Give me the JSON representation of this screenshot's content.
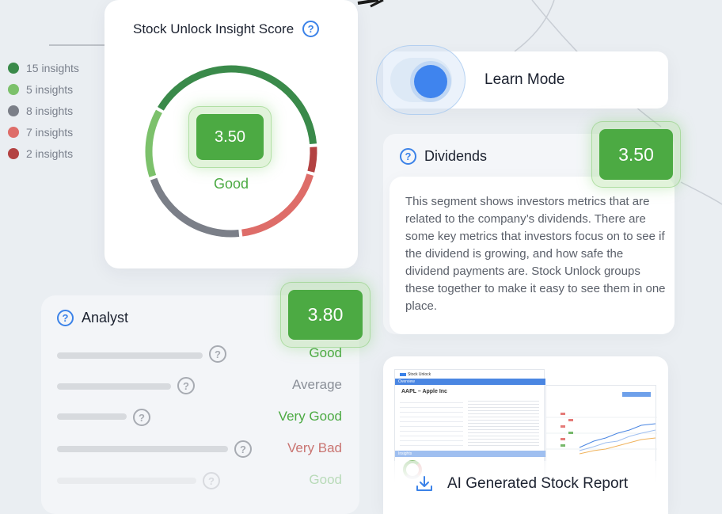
{
  "legend": [
    {
      "label": "15 insights",
      "color": "#3a8a4a"
    },
    {
      "label": "5 insights",
      "color": "#7cc16b"
    },
    {
      "label": "8 insights",
      "color": "#7b7f88"
    },
    {
      "label": "7 insights",
      "color": "#de6d69"
    },
    {
      "label": "2 insights",
      "color": "#b34242"
    }
  ],
  "score_card": {
    "title": "Stock Unlock Insight Score",
    "score": "3.50",
    "rating": "Good",
    "segments": [
      {
        "name": "15 insights",
        "value": 15,
        "color": "#3a8a4a"
      },
      {
        "name": "2 insights",
        "value": 2,
        "color": "#b34242"
      },
      {
        "name": "7 insights",
        "value": 7,
        "color": "#de6d69"
      },
      {
        "name": "8 insights",
        "value": 8,
        "color": "#7b7f88"
      },
      {
        "name": "5 insights",
        "value": 5,
        "color": "#7cc16b"
      }
    ]
  },
  "learn_mode": {
    "label": "Learn Mode",
    "enabled": true,
    "accent": "#3f84ee"
  },
  "dividends": {
    "title": "Dividends",
    "score": "3.50",
    "description": "This segment shows investors metrics that are related to the company’s dividends. There are some key metrics that investors focus on to see if the dividend is growing, and how safe the dividend payments are. Stock Unlock groups these together to make it easy to see them in one place."
  },
  "analyst": {
    "title": "Analyst",
    "score": "3.80",
    "rows": [
      {
        "rating": "Good",
        "color": "#4caa43"
      },
      {
        "rating": "Average",
        "color": "#8a8f98"
      },
      {
        "rating": "Very Good",
        "color": "#4caa43"
      },
      {
        "rating": "Very Bad",
        "color": "#c97471"
      },
      {
        "rating": "Good",
        "color": "#4caa43"
      }
    ]
  },
  "report": {
    "label": "AI Generated Stock Report",
    "icon": "download-icon",
    "preview": {
      "brand": "Stock Unlock",
      "company": "AAPL – Apple Inc",
      "section_overview": "Overview",
      "section_insights": "Insights"
    }
  },
  "colors": {
    "good": "#4caa43",
    "brand_blue": "#3b82e8"
  }
}
